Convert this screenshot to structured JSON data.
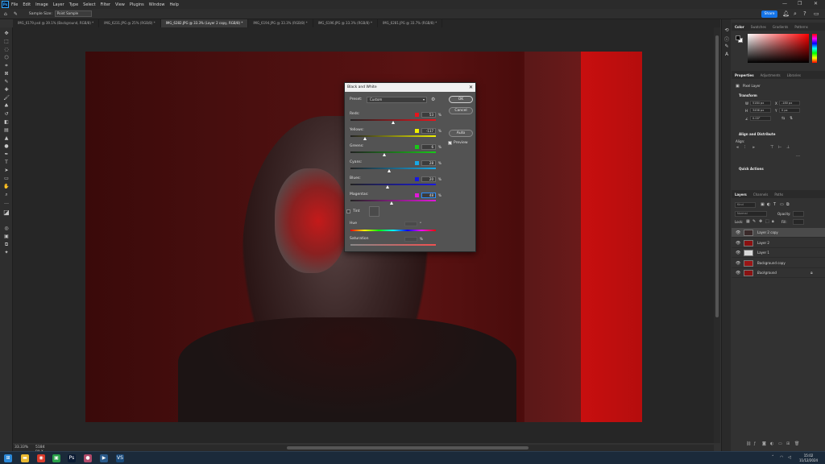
{
  "app": {
    "logo": "Ps",
    "menu": [
      "File",
      "Edit",
      "Image",
      "Layer",
      "Type",
      "Select",
      "Filter",
      "View",
      "Plugins",
      "Window",
      "Help"
    ],
    "window_controls": [
      "—",
      "❐",
      "✕"
    ]
  },
  "options_bar": {
    "sample_size_label": "Sample Size:",
    "sample_size_value": "Point Sample",
    "share_label": "Share",
    "icons": [
      "bell-icon",
      "search-icon",
      "help-icon",
      "workspace-icon"
    ]
  },
  "tabs": [
    {
      "label": "IMG_6179.psd @ 39.1% (Background, RGB/8) *",
      "active": false
    },
    {
      "label": "IMG_6231.JPG @ 25% (RGB/8) *",
      "active": false
    },
    {
      "label": "IMG_6282.JPG @ 33.3% (Layer 2 copy, RGB/8) *",
      "active": true
    },
    {
      "label": "IMG_6194.JPG @ 33.3% (RGB/8) *",
      "active": false
    },
    {
      "label": "IMG_6196.JPG @ 33.3% (RGB/8) *",
      "active": false
    },
    {
      "label": "IMG_6281.JPG @ 33.7% (RGB/8) *",
      "active": false
    }
  ],
  "status": {
    "zoom": "33.33%",
    "doc_info": "5184 px x 3456 px (72 ppi)"
  },
  "color_panel": {
    "tabs": [
      "Color",
      "Swatches",
      "Gradients",
      "Patterns"
    ]
  },
  "properties_panel": {
    "tabs": [
      "Properties",
      "Adjustments",
      "Libraries"
    ],
    "layer_type": "Pixel Layer",
    "transform_title": "Transform",
    "w_label": "W",
    "w_value": "5184 px",
    "x_label": "X",
    "x_value": "-180 px",
    "h_label": "H",
    "h_value": "3456 px",
    "y_label": "Y",
    "y_value": "0 px",
    "angle_value": "0.00°",
    "align_title": "Align and Distribute",
    "align_label": "Align:",
    "quick_actions_title": "Quick Actions"
  },
  "layers_panel": {
    "tabs": [
      "Layers",
      "Channels",
      "Paths"
    ],
    "kind_label": "Kind",
    "blend_mode": "Normal",
    "opacity_label": "Opacity:",
    "lock_label": "Lock:",
    "fill_label": "Fill:",
    "layers": [
      {
        "name": "Layer 2 copy",
        "selected": true,
        "thumb": "#3a2a2a",
        "lock": false,
        "italic": false
      },
      {
        "name": "Layer 2",
        "selected": false,
        "thumb": "#8a1010",
        "lock": false,
        "italic": false
      },
      {
        "name": "Layer 1",
        "selected": false,
        "thumb": "#d8d8d8",
        "lock": false,
        "italic": false
      },
      {
        "name": "Background copy",
        "selected": false,
        "thumb": "#9a1515",
        "lock": false,
        "italic": false
      },
      {
        "name": "Background",
        "selected": false,
        "thumb": "#8a1212",
        "lock": true,
        "italic": true
      }
    ]
  },
  "dialog": {
    "title": "Black and White",
    "preset_label": "Preset:",
    "preset_value": "Custom",
    "ok_label": "OK",
    "cancel_label": "Cancel",
    "auto_label": "Auto",
    "preview_label": "Preview",
    "preview_checked": true,
    "channels": [
      {
        "label": "Reds:",
        "value": "53",
        "color": "#e8141c",
        "grad": "linear-gradient(90deg,#222,#e8141c)",
        "pos": 0.5
      },
      {
        "label": "Yellows:",
        "value": "-117",
        "color": "#f0f000",
        "grad": "linear-gradient(90deg,#222,#f0f000)",
        "pos": 0.17
      },
      {
        "label": "Greens:",
        "value": "6",
        "color": "#18c818",
        "grad": "linear-gradient(90deg,#222,#18c818)",
        "pos": 0.4
      },
      {
        "label": "Cyans:",
        "value": "28",
        "color": "#18a8e8",
        "grad": "linear-gradient(90deg,#222,#18a8e8)",
        "pos": 0.46
      },
      {
        "label": "Blues:",
        "value": "20",
        "color": "#1818e0",
        "grad": "linear-gradient(90deg,#222,#1818e0)",
        "pos": 0.44
      },
      {
        "label": "Magentas:",
        "value": "48",
        "color": "#e018d8",
        "grad": "linear-gradient(90deg,#222,#e018d8)",
        "pos": 0.49
      }
    ],
    "percent_sign": "%",
    "tint_label": "Tint",
    "tint_checked": false,
    "hue_label": "Hue",
    "hue_unit": "°",
    "saturation_label": "Saturation",
    "saturation_unit": "%"
  },
  "taskbar": {
    "time": "15:02",
    "date": "11/12/2024",
    "apps": [
      {
        "name": "windows-start-icon",
        "color": "#2b88d8",
        "glyph": "⊞"
      },
      {
        "name": "file-explorer-icon",
        "color": "#e8b830",
        "glyph": "▬"
      },
      {
        "name": "chrome-icon",
        "color": "#d83a2a",
        "glyph": "◉"
      },
      {
        "name": "green-app-icon",
        "color": "#28a048",
        "glyph": "▣"
      },
      {
        "name": "photoshop-taskbar-icon",
        "color": "#0a1a33",
        "glyph": "Ps"
      },
      {
        "name": "browser-app-icon",
        "color": "#b04a6a",
        "glyph": "●"
      },
      {
        "name": "media-app-icon",
        "color": "#2a5a8a",
        "glyph": "▶"
      },
      {
        "name": "code-app-icon",
        "color": "#1a4a7a",
        "glyph": "VS"
      }
    ]
  }
}
